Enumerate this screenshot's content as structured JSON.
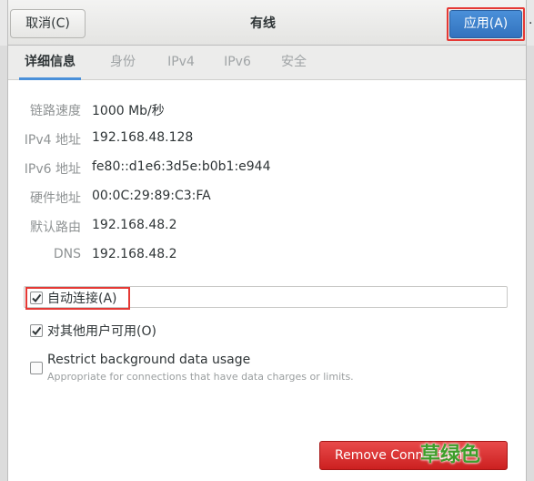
{
  "header": {
    "cancel_label": "取消(C)",
    "title": "有线",
    "apply_label": "应用(A)"
  },
  "tabs": [
    {
      "label": "详细信息",
      "active": true
    },
    {
      "label": "身份",
      "active": false
    },
    {
      "label": "IPv4",
      "active": false
    },
    {
      "label": "IPv6",
      "active": false
    },
    {
      "label": "安全",
      "active": false
    }
  ],
  "details": [
    {
      "label": "链路速度",
      "value": "1000 Mb/秒"
    },
    {
      "label": "IPv4 地址",
      "value": "192.168.48.128"
    },
    {
      "label": "IPv6 地址",
      "value": "fe80::d1e6:3d5e:b0b1:e944"
    },
    {
      "label": "硬件地址",
      "value": "00:0C:29:89:C3:FA"
    },
    {
      "label": "默认路由",
      "value": "192.168.48.2"
    },
    {
      "label": "DNS",
      "value": "192.168.48.2"
    }
  ],
  "options": {
    "auto_connect": {
      "label": "自动连接(A)",
      "checked": true
    },
    "all_users": {
      "label": "对其他用户可用(O)",
      "checked": true
    },
    "restrict_bg": {
      "label": "Restrict background data usage",
      "description": "Appropriate for connections that have data charges or limits.",
      "checked": false
    }
  },
  "remove_button_label": "Remove Connection",
  "watermark_text": "草绿色",
  "colors": {
    "accent": "#4a90d9",
    "highlight": "#e53935",
    "danger": "#d32f2f",
    "watermark": "#3d9e2a"
  }
}
